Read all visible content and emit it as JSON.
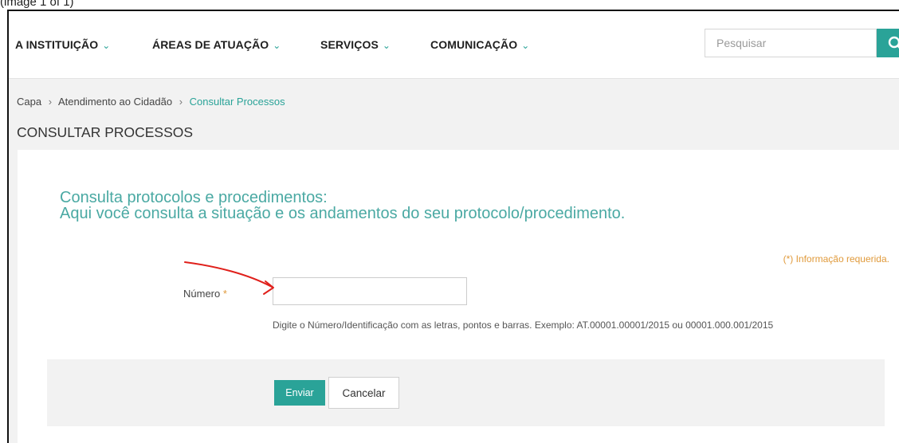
{
  "caption": "(image 1 of 1)",
  "nav": {
    "items": [
      {
        "label": "A INSTITUIÇÃO"
      },
      {
        "label": "ÁREAS DE ATUAÇÃO"
      },
      {
        "label": "SERVIÇOS"
      },
      {
        "label": "COMUNICAÇÃO"
      }
    ],
    "search_placeholder": "Pesquisar"
  },
  "breadcrumb": {
    "items": [
      "Capa",
      "Atendimento ao Cidadão"
    ],
    "separator": "›",
    "current": "Consultar Processos"
  },
  "page": {
    "title": "CONSULTAR PROCESSOS"
  },
  "form": {
    "headline_line1": "Consulta protocolos e procedimentos:",
    "headline_line2": "Aqui você consulta a situação e os andamentos do seu protocolo/procedimento.",
    "required_note": "(*) Informação requerida.",
    "numero_label": "Número",
    "required_marker": "*",
    "numero_value": "",
    "help_text": "Digite o Número/Identificação com as letras, pontos e barras. Exemplo: AT.00001.00001/2015 ou 00001.000.001/2015",
    "submit_label": "Enviar",
    "cancel_label": "Cancelar"
  },
  "colors": {
    "accent": "#2aa398",
    "headline": "#4aa9a3",
    "required": "#e09a3b",
    "annotation": "#e0201b"
  },
  "icons": {
    "search": "search-icon",
    "dropdown": "chevron-down-icon"
  }
}
